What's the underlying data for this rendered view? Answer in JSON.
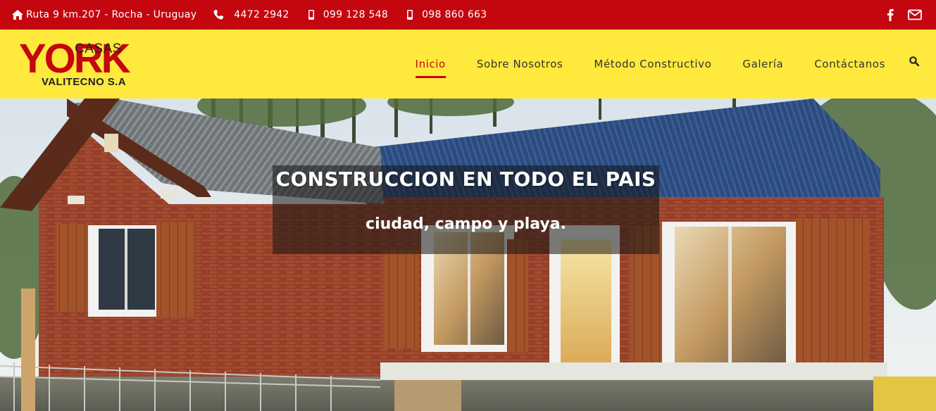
{
  "topbar": {
    "address": "Ruta 9 km.207 - Rocha - Uruguay",
    "phone": "4472 2942",
    "mobile1": "099 128 548",
    "mobile2": "098 860 663",
    "social": [
      "facebook-icon",
      "envelope-icon"
    ]
  },
  "logo": {
    "casas": "CASAS",
    "york": "YORK",
    "company": "VALITECNO S.A"
  },
  "nav": {
    "items": [
      {
        "label": "Inicio",
        "active": true
      },
      {
        "label": "Sobre Nosotros",
        "active": false
      },
      {
        "label": "Método Constructivo",
        "active": false
      },
      {
        "label": "Galería",
        "active": false
      },
      {
        "label": "Contáctanos",
        "active": false
      }
    ],
    "search_icon": "search-icon"
  },
  "hero": {
    "headline": "CONSTRUCCION EN TODO EL PAIS",
    "subheadline": "ciudad, campo y playa."
  },
  "colors": {
    "topbar": "#c4060f",
    "header": "#ffe93c",
    "accent": "#c4060f"
  }
}
